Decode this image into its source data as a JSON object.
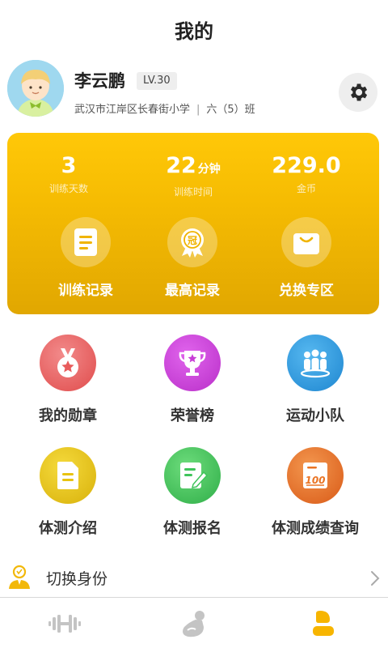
{
  "header": {
    "title": "我的"
  },
  "profile": {
    "name": "李云鹏",
    "level": "LV.30",
    "school": "武汉市江岸区长春街小学",
    "class": "六（5）班",
    "separator": "|"
  },
  "stats": [
    {
      "value": "3",
      "unit": "",
      "label": "训练天数"
    },
    {
      "value": "22",
      "unit": "分钟",
      "label": "训练时间"
    },
    {
      "value": "229.0",
      "unit": "",
      "label": "金币"
    }
  ],
  "quick_actions": [
    {
      "label": "训练记录",
      "icon": "record-book-icon"
    },
    {
      "label": "最高记录",
      "icon": "crown-badge-icon"
    },
    {
      "label": "兑换专区",
      "icon": "shopping-bag-icon"
    }
  ],
  "menu": [
    {
      "label": "我的勋章",
      "icon": "medal-icon"
    },
    {
      "label": "荣誉榜",
      "icon": "trophy-icon"
    },
    {
      "label": "运动小队",
      "icon": "team-icon"
    },
    {
      "label": "体测介绍",
      "icon": "document-icon"
    },
    {
      "label": "体测报名",
      "icon": "edit-form-icon"
    },
    {
      "label": "体测成绩查询",
      "icon": "score-100-icon"
    }
  ],
  "switch_identity": {
    "label": "切换身份"
  },
  "tabbar": {
    "items": [
      "dumbbell-icon",
      "arm-muscle-icon",
      "profile-icon"
    ],
    "active_index": 2
  },
  "colors": {
    "card_yellow": "#f5bb02",
    "active_tab": "#f7b500",
    "inactive_tab": "#c4c4c4",
    "medal": "#e85c5c",
    "trophy": "#c83dd6",
    "team": "#2f9be0",
    "intro": "#e8c310",
    "signup": "#3fc45a",
    "score": "#ea7424"
  }
}
